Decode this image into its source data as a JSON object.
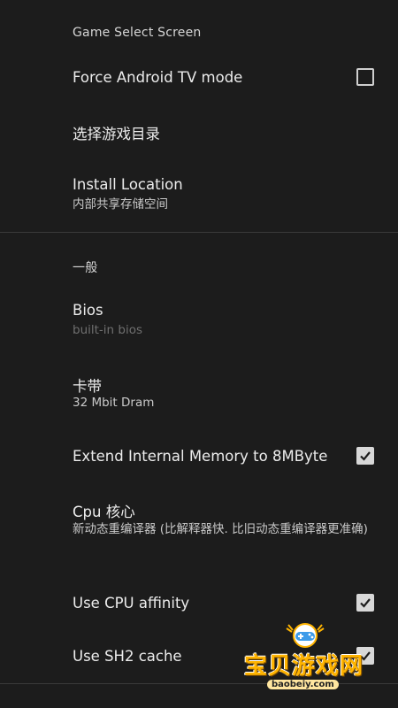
{
  "sections": {
    "game_select": "Game Select Screen",
    "general": "一般"
  },
  "prefs": {
    "force_tv": {
      "title": "Force Android TV mode",
      "checked": false
    },
    "game_dir": {
      "title": "选择游戏目录"
    },
    "install_location": {
      "title": "Install Location",
      "summary": "内部共享存储空间"
    },
    "bios": {
      "title": "Bios",
      "summary": "built-in bios"
    },
    "cartridge": {
      "title": "卡带",
      "summary": "32 Mbit Dram"
    },
    "extend_memory": {
      "title": "Extend Internal Memory to 8MByte",
      "checked": true
    },
    "cpu_core": {
      "title": "Cpu 核心",
      "summary": "新动态重编译器 (比解释器快. 比旧动态重编译器更准确)"
    },
    "cpu_affinity": {
      "title": "Use CPU affinity",
      "checked": true
    },
    "sh2_cache": {
      "title": "Use SH2 cache",
      "checked": true
    }
  },
  "watermark": {
    "name": "宝贝游戏网",
    "url": "baobeiy.com",
    "icon": "gamepad-icon"
  },
  "colors": {
    "background": "#1c1c1c",
    "divider": "#3a3a3a",
    "watermark": "#ffb400"
  }
}
